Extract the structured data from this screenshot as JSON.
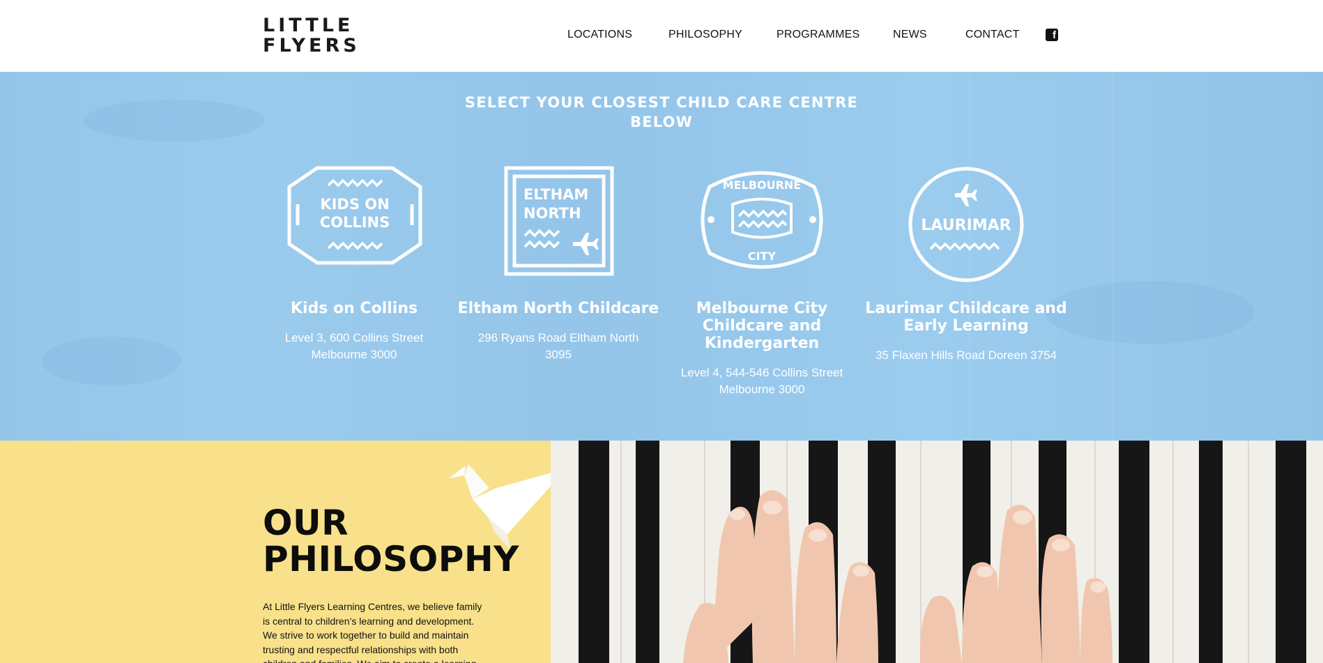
{
  "header": {
    "logo_line1": "LITTLE",
    "logo_line2": "FLYERS",
    "nav": [
      {
        "label": "LOCATIONS"
      },
      {
        "label": "PHILOSOPHY"
      },
      {
        "label": "PROGRAMMES"
      },
      {
        "label": "NEWS"
      },
      {
        "label": "CONTACT"
      }
    ],
    "social_icon": "facebook-icon"
  },
  "centres": {
    "title_line1": "SELECT YOUR CLOSEST CHILD CARE CENTRE",
    "title_line2": "BELOW",
    "items": [
      {
        "badge_line1": "KIDS ON",
        "badge_line2": "COLLINS",
        "name_lines": [
          "Kids on Collins"
        ],
        "address_lines": [
          "Level 3, 600 Collins Street",
          "Melbourne 3000"
        ]
      },
      {
        "badge_line1": "ELTHAM",
        "badge_line2": "NORTH",
        "name_lines": [
          "Eltham North Childcare"
        ],
        "address_lines": [
          "296 Ryans Road Eltham North",
          "3095"
        ]
      },
      {
        "badge_top": "MELBOURNE",
        "badge_bottom": "CITY",
        "name_lines": [
          "Melbourne City",
          "Childcare and",
          "Kindergarten"
        ],
        "address_lines": [
          "Level 4, 544-546 Collins Street",
          "Melbourne 3000"
        ]
      },
      {
        "badge_line1": "LAURIMAR",
        "name_lines": [
          "Laurimar Childcare and",
          "Early Learning"
        ],
        "address_lines": [
          "35 Flaxen Hills Road Doreen 3754"
        ]
      }
    ]
  },
  "philosophy": {
    "title_line1": "OUR",
    "title_line2": "PHILOSOPHY",
    "body_lines": [
      "At Little Flyers Learning Centres, we believe family",
      "is central to children’s learning and development.",
      "We strive to work together to build and maintain",
      "trusting and respectful relationships with both",
      "children and families. We aim to create a learning"
    ]
  },
  "colors": {
    "centres_bg": "#9acbed",
    "philosophy_bg": "#f8e18a",
    "text_dark": "#111111"
  }
}
